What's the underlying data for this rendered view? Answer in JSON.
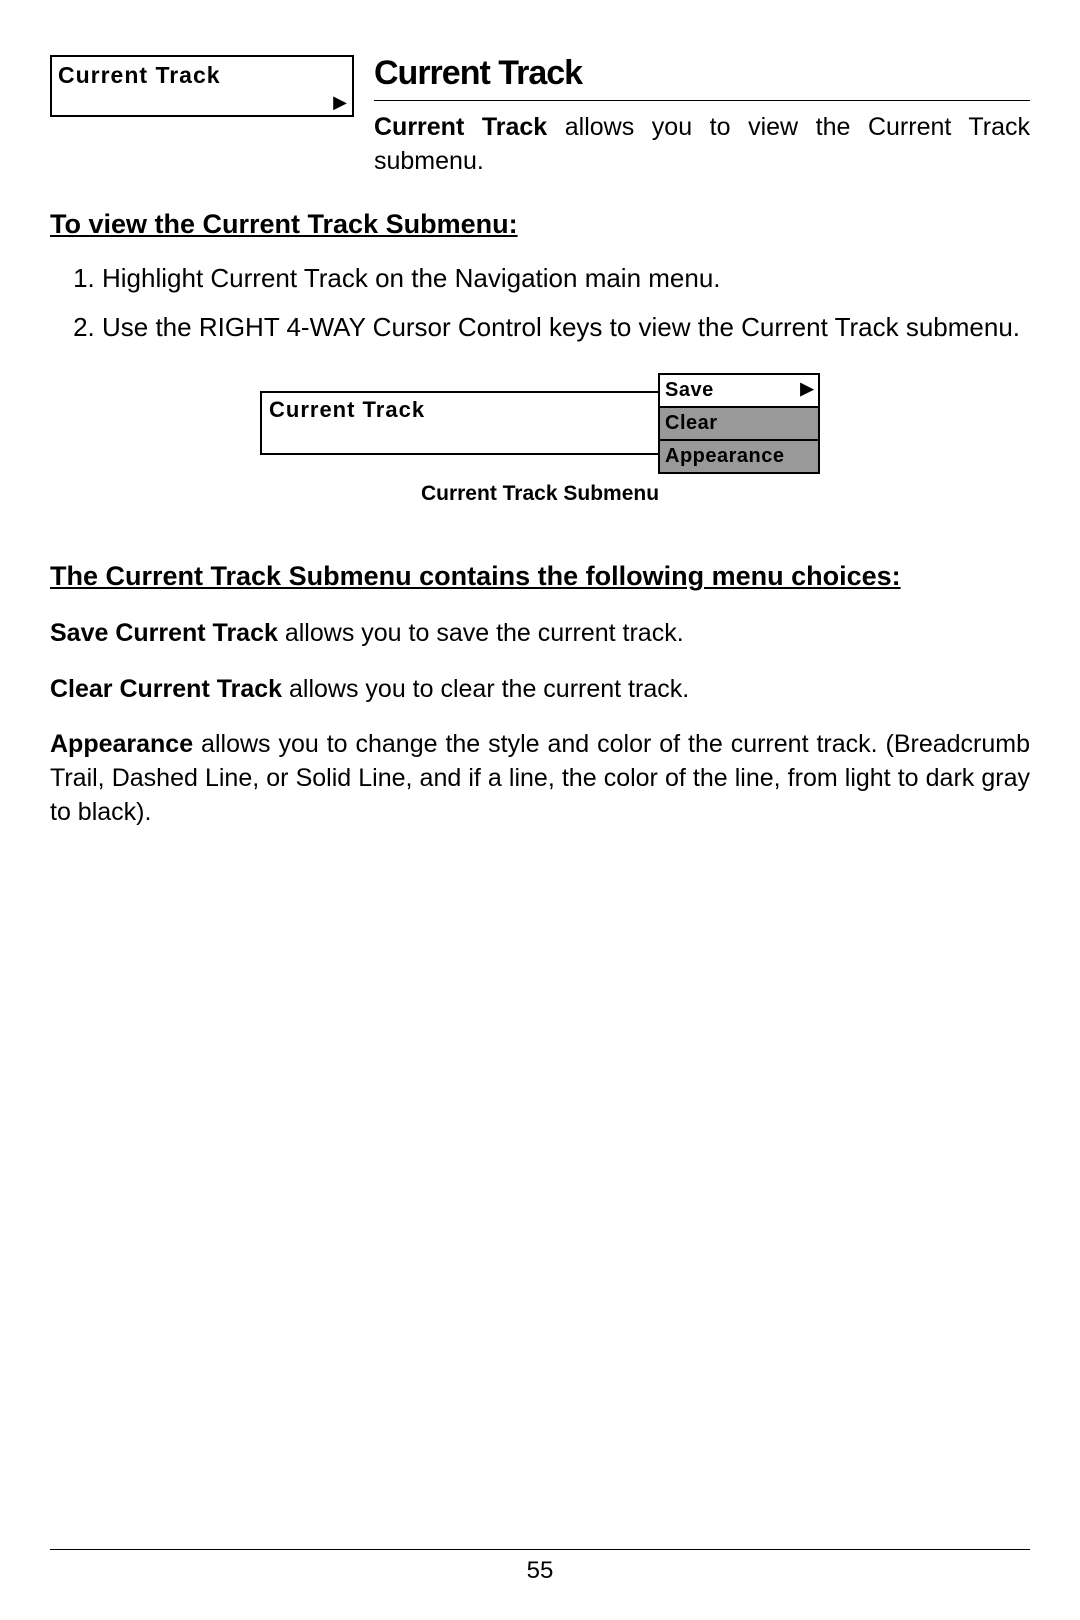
{
  "menuIcon": {
    "label": "Current Track"
  },
  "title": "Current Track",
  "intro": {
    "lead": "Current Track",
    "rest": " allows you to view the Current Track submenu."
  },
  "viewHeading": "To view the Current Track Submenu:",
  "steps": [
    "Highlight Current Track on the Navigation main menu.",
    "Use the RIGHT 4-WAY Cursor Control keys to view the Current Track submenu."
  ],
  "figure": {
    "mainLabel": "Current Track",
    "submenu": [
      "Save",
      "Clear",
      "Appearance"
    ],
    "caption": "Current Track Submenu"
  },
  "choicesHeading": "The Current Track Submenu contains the following menu choices:",
  "choices": [
    {
      "lead": "Save Current Track",
      "rest": " allows you to save the current track."
    },
    {
      "lead": "Clear Current Track",
      "rest": " allows you to clear the current track."
    },
    {
      "lead": "Appearance",
      "rest": " allows you to change the style and color of the current track. (Breadcrumb Trail, Dashed Line, or Solid Line, and if a line, the color of the line, from light to dark gray to black)."
    }
  ],
  "pageNumber": "55"
}
